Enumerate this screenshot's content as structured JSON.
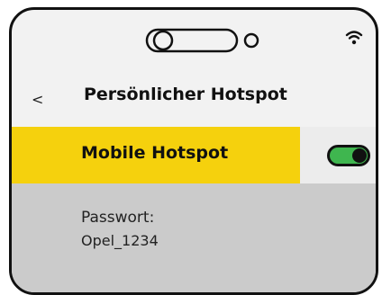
{
  "screen": {
    "back_label": "<",
    "title": "Persönlicher Hotspot"
  },
  "icons": {
    "notch": "camera-notch-icon",
    "status": "wifi-icon"
  },
  "hotspot": {
    "label": "Mobile Hotspot",
    "enabled": true,
    "colors": {
      "accent": "#f5d10d",
      "toggle_on": "#3fb64f"
    }
  },
  "password": {
    "label": "Passwort:",
    "value": "Opel_1234"
  }
}
